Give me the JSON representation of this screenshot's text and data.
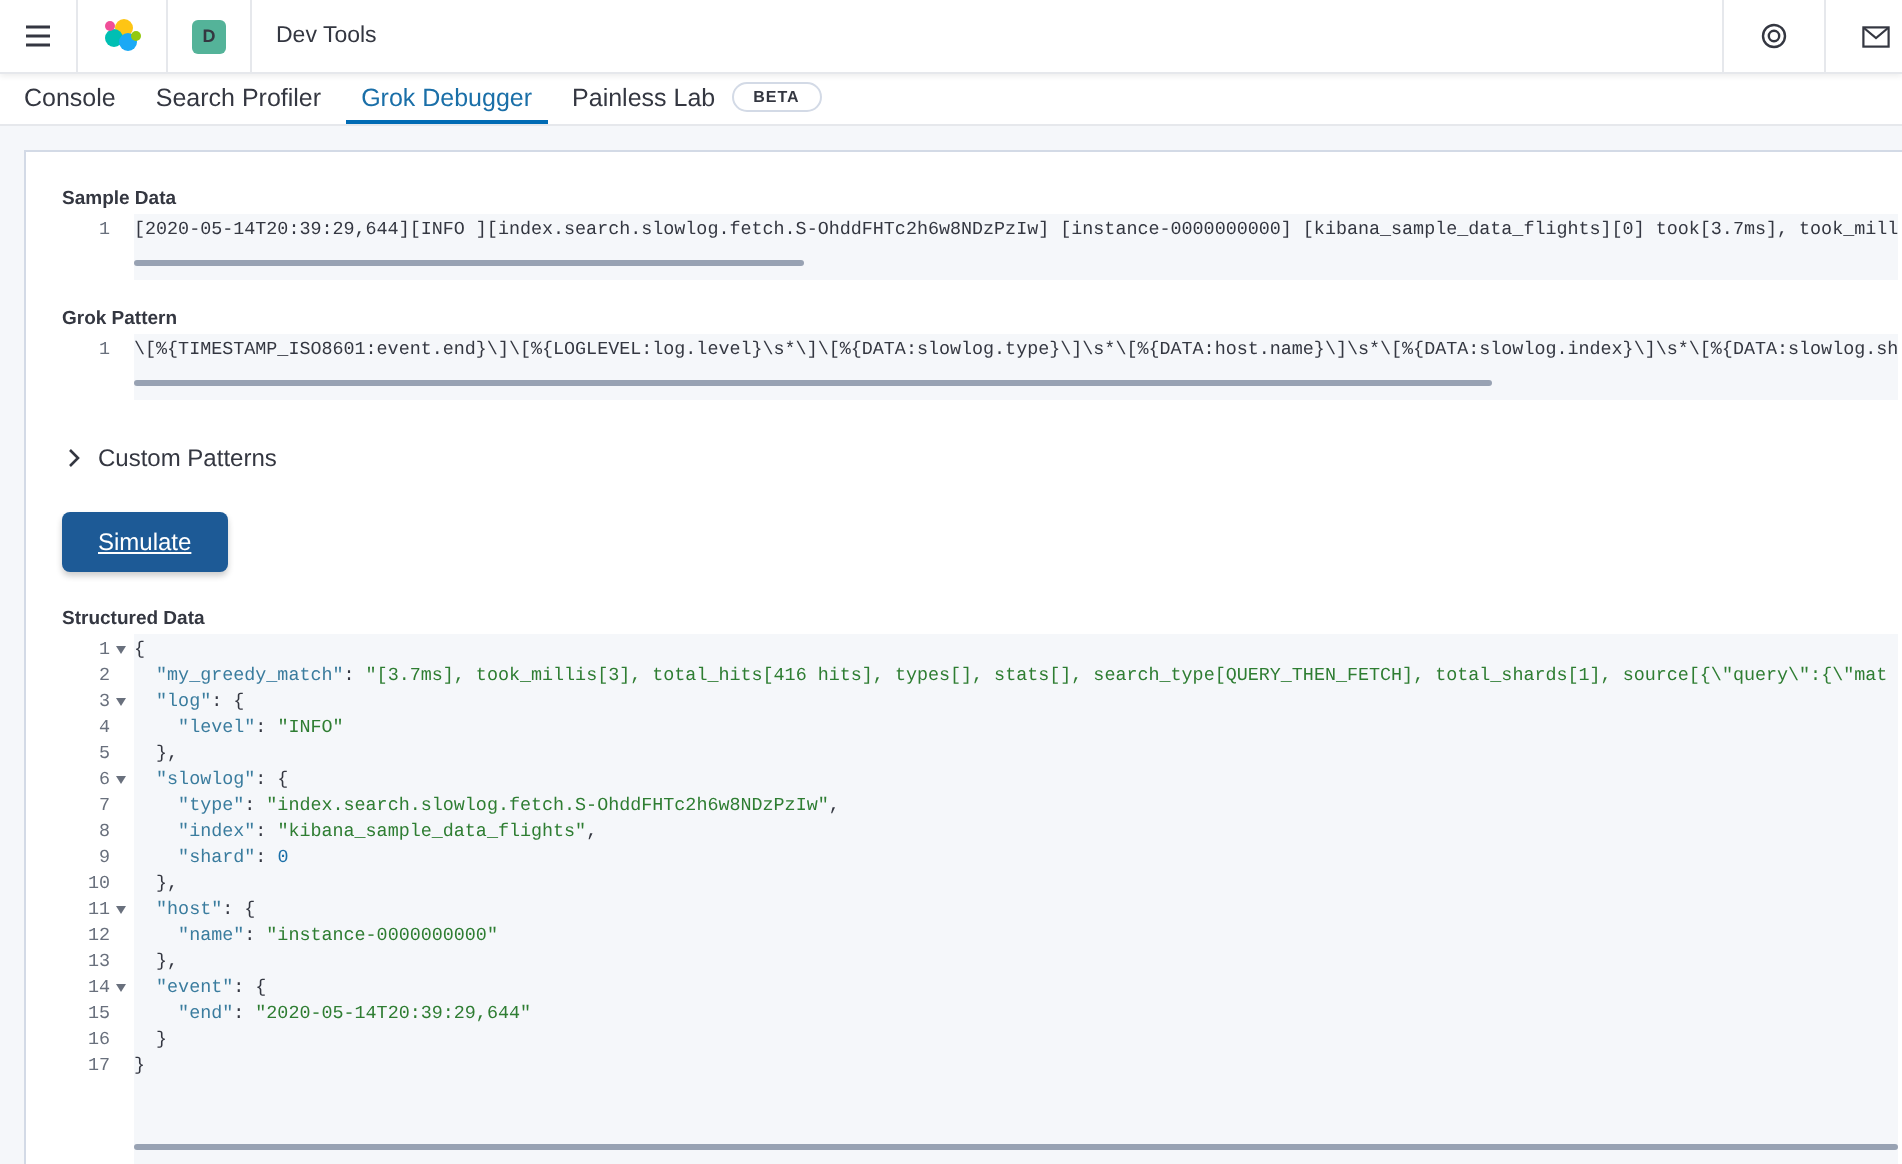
{
  "header": {
    "avatar": "D",
    "title": "Dev Tools"
  },
  "tabs": [
    {
      "label": "Console",
      "selected": false
    },
    {
      "label": "Search Profiler",
      "selected": false
    },
    {
      "label": "Grok Debugger",
      "selected": true
    },
    {
      "label": "Painless Lab",
      "selected": false,
      "badge": "BETA"
    }
  ],
  "sample_data": {
    "label": "Sample Data",
    "lines": [
      {
        "number": "1",
        "text": "[2020-05-14T20:39:29,644][INFO ][index.search.slowlog.fetch.S-OhddFHTc2h6w8NDzPzIw] [instance-0000000000] [kibana_sample_data_flights][0] took[3.7ms], took_mill"
      }
    ]
  },
  "grok_pattern": {
    "label": "Grok Pattern",
    "lines": [
      {
        "number": "1",
        "text": "\\[%{TIMESTAMP_ISO8601:event.end}\\]\\[%{LOGLEVEL:log.level}\\s*\\]\\[%{DATA:slowlog.type}\\]\\s*\\[%{DATA:host.name}\\]\\s*\\[%{DATA:slowlog.index}\\]\\s*\\[%{DATA:slowlog.sh"
      }
    ]
  },
  "custom_patterns": {
    "label": "Custom Patterns",
    "expanded": false
  },
  "simulate_button": "Simulate",
  "structured_data": {
    "label": "Structured Data",
    "lines": [
      {
        "number": "1",
        "foldable": true,
        "tokens": [
          {
            "kind": "punct",
            "text": "{"
          }
        ]
      },
      {
        "number": "2",
        "foldable": false,
        "tokens": [
          {
            "kind": "key",
            "text": "  \"my_greedy_match\""
          },
          {
            "kind": "punct",
            "text": ": "
          },
          {
            "kind": "string",
            "text": "\"[3.7ms], took_millis[3], total_hits[416 hits], types[], stats[], search_type[QUERY_THEN_FETCH], total_shards[1], source[{\\\"query\\\":{\\\"mat"
          }
        ]
      },
      {
        "number": "3",
        "foldable": true,
        "tokens": [
          {
            "kind": "key",
            "text": "  \"log\""
          },
          {
            "kind": "punct",
            "text": ": {"
          }
        ]
      },
      {
        "number": "4",
        "foldable": false,
        "tokens": [
          {
            "kind": "key",
            "text": "    \"level\""
          },
          {
            "kind": "punct",
            "text": ": "
          },
          {
            "kind": "string",
            "text": "\"INFO\""
          }
        ]
      },
      {
        "number": "5",
        "foldable": false,
        "tokens": [
          {
            "kind": "punct",
            "text": "  },"
          }
        ]
      },
      {
        "number": "6",
        "foldable": true,
        "tokens": [
          {
            "kind": "key",
            "text": "  \"slowlog\""
          },
          {
            "kind": "punct",
            "text": ": {"
          }
        ]
      },
      {
        "number": "7",
        "foldable": false,
        "tokens": [
          {
            "kind": "key",
            "text": "    \"type\""
          },
          {
            "kind": "punct",
            "text": ": "
          },
          {
            "kind": "string",
            "text": "\"index.search.slowlog.fetch.S-OhddFHTc2h6w8NDzPzIw\""
          },
          {
            "kind": "punct",
            "text": ","
          }
        ]
      },
      {
        "number": "8",
        "foldable": false,
        "tokens": [
          {
            "kind": "key",
            "text": "    \"index\""
          },
          {
            "kind": "punct",
            "text": ": "
          },
          {
            "kind": "string",
            "text": "\"kibana_sample_data_flights\""
          },
          {
            "kind": "punct",
            "text": ","
          }
        ]
      },
      {
        "number": "9",
        "foldable": false,
        "tokens": [
          {
            "kind": "key",
            "text": "    \"shard\""
          },
          {
            "kind": "punct",
            "text": ": "
          },
          {
            "kind": "number",
            "text": "0"
          }
        ]
      },
      {
        "number": "10",
        "foldable": false,
        "tokens": [
          {
            "kind": "punct",
            "text": "  },"
          }
        ]
      },
      {
        "number": "11",
        "foldable": true,
        "tokens": [
          {
            "kind": "key",
            "text": "  \"host\""
          },
          {
            "kind": "punct",
            "text": ": {"
          }
        ]
      },
      {
        "number": "12",
        "foldable": false,
        "tokens": [
          {
            "kind": "key",
            "text": "    \"name\""
          },
          {
            "kind": "punct",
            "text": ": "
          },
          {
            "kind": "string",
            "text": "\"instance-0000000000\""
          }
        ]
      },
      {
        "number": "13",
        "foldable": false,
        "tokens": [
          {
            "kind": "punct",
            "text": "  },"
          }
        ]
      },
      {
        "number": "14",
        "foldable": true,
        "tokens": [
          {
            "kind": "key",
            "text": "  \"event\""
          },
          {
            "kind": "punct",
            "text": ": {"
          }
        ]
      },
      {
        "number": "15",
        "foldable": false,
        "tokens": [
          {
            "kind": "key",
            "text": "    \"end\""
          },
          {
            "kind": "punct",
            "text": ": "
          },
          {
            "kind": "string",
            "text": "\"2020-05-14T20:39:29,644\""
          }
        ]
      },
      {
        "number": "16",
        "foldable": false,
        "tokens": [
          {
            "kind": "punct",
            "text": "  }"
          }
        ]
      },
      {
        "number": "17",
        "foldable": false,
        "tokens": [
          {
            "kind": "punct",
            "text": "}"
          }
        ]
      }
    ]
  }
}
